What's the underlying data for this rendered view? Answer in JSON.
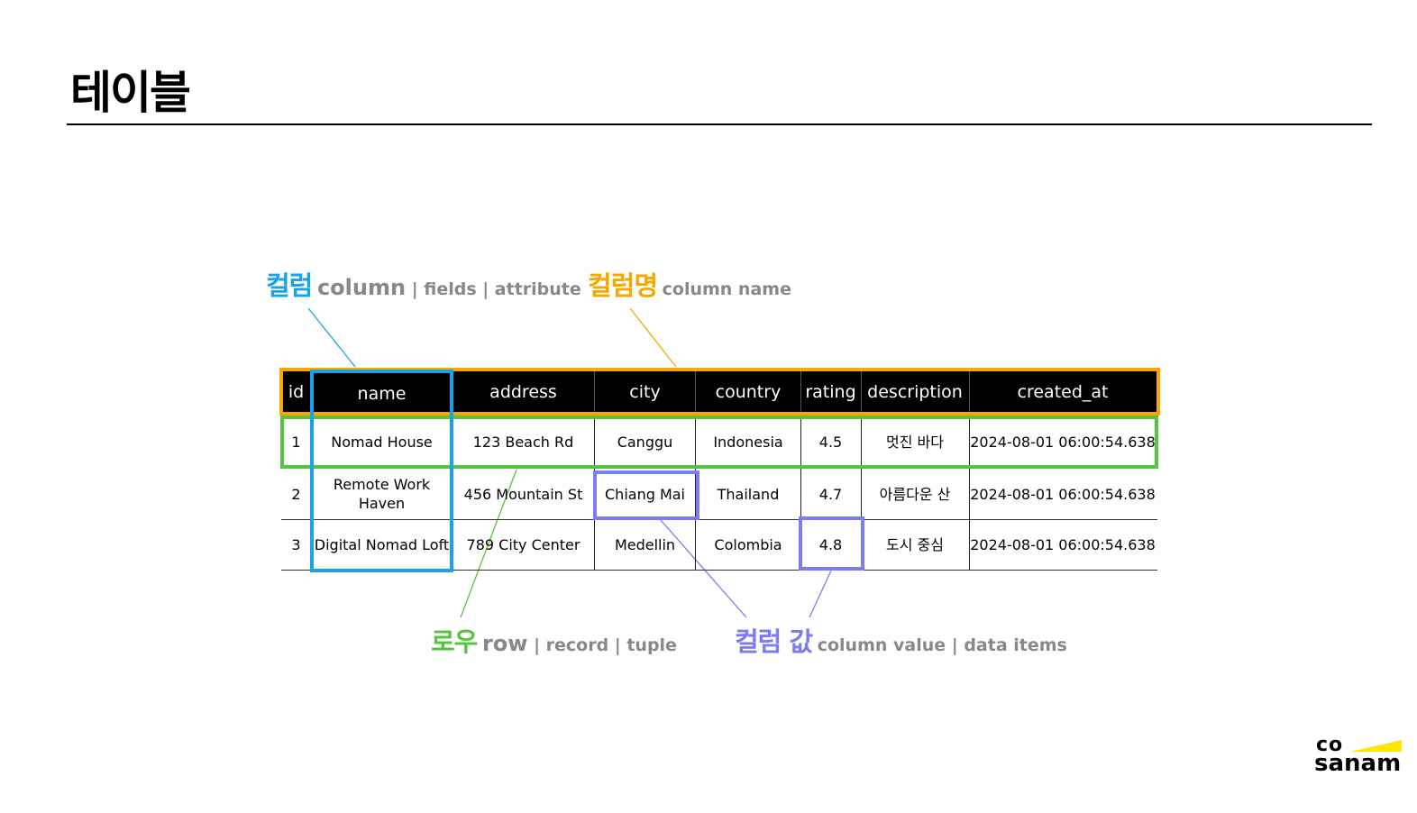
{
  "page": {
    "title": "테이블"
  },
  "table": {
    "headers": [
      "id",
      "name",
      "address",
      "city",
      "country",
      "rating",
      "description",
      "created_at"
    ],
    "rows": [
      [
        "1",
        "Nomad House",
        "123 Beach Rd",
        "Canggu",
        "Indonesia",
        "4.5",
        "멋진 바다",
        "2024-08-01 06:00:54.638"
      ],
      [
        "2",
        "Remote Work Haven",
        "456 Mountain St",
        "Chiang Mai",
        "Thailand",
        "4.7",
        "아름다운 산",
        "2024-08-01 06:00:54.638"
      ],
      [
        "3",
        "Digital Nomad Loft",
        "789 City Center",
        "Medellin",
        "Colombia",
        "4.8",
        "도시 중심",
        "2024-08-01 06:00:54.638"
      ]
    ]
  },
  "labels": {
    "column": {
      "ko": "컬럼",
      "en": "column",
      "rest": " | fields | attribute"
    },
    "column_name": {
      "ko": "컬럼명",
      "en": "column name"
    },
    "row": {
      "ko": "로우",
      "en": "row",
      "rest": " | record | tuple"
    },
    "column_value": {
      "ko": "컬럼 값",
      "en": "column value | data items"
    }
  },
  "colors": {
    "column": "#1AA2E8",
    "column_name": "#F5A800",
    "row": "#55C53D",
    "column_value": "#7B7BF2",
    "header_bg": "#000000",
    "logo_accent": "#FFE600"
  },
  "logo": {
    "line1": "co",
    "line2": "sanam"
  }
}
